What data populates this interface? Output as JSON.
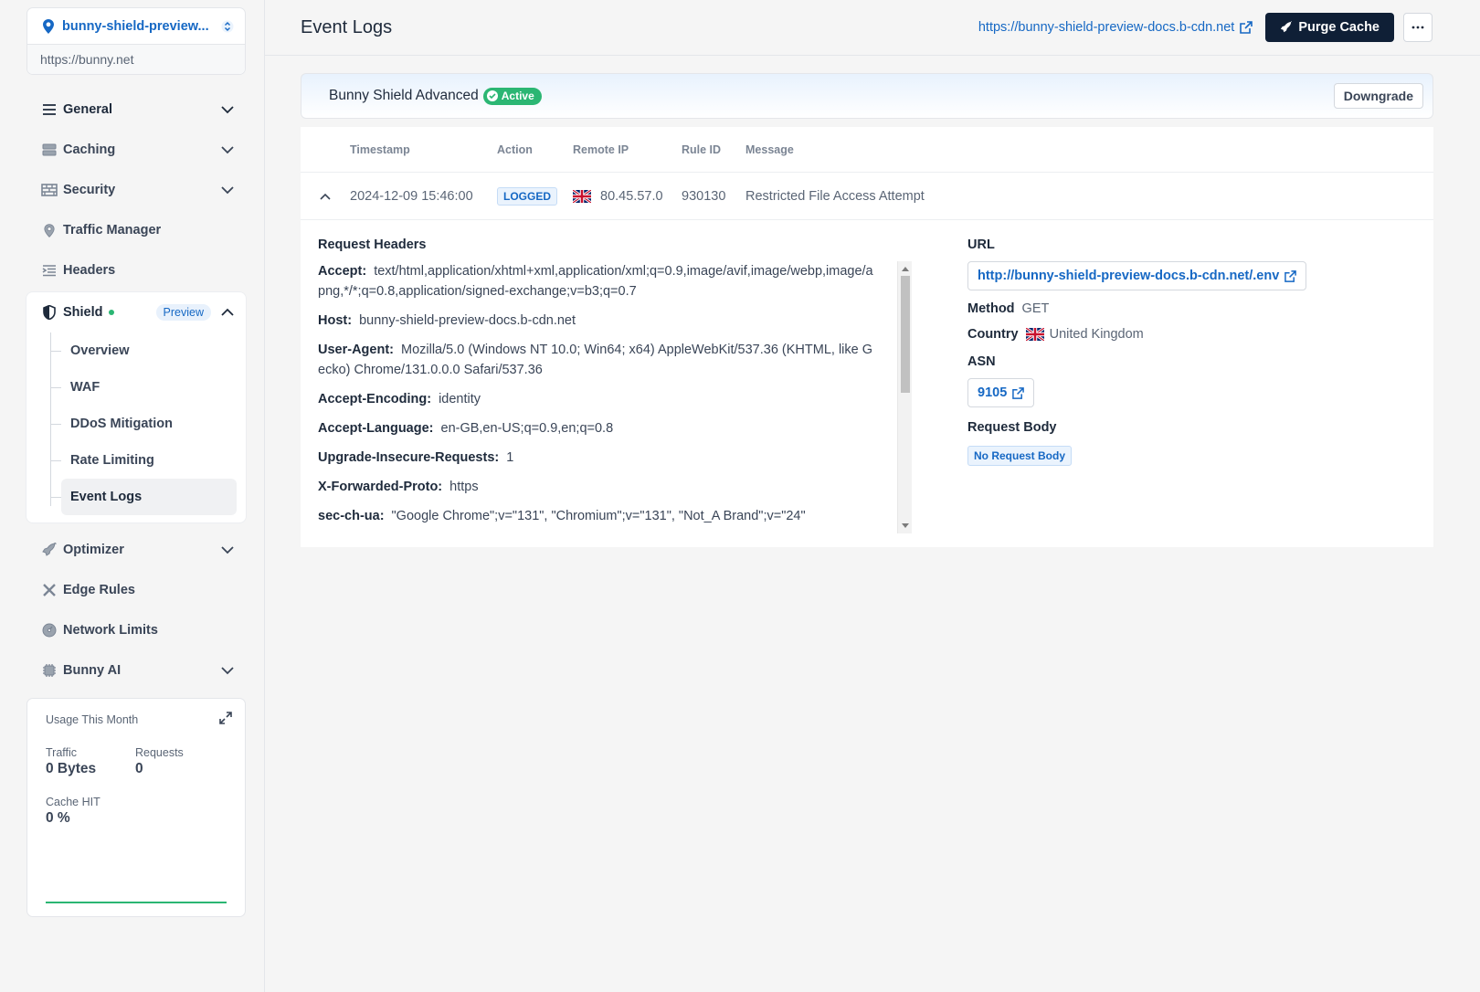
{
  "zone": {
    "name": "bunny-shield-preview...",
    "url": "https://bunny.net"
  },
  "nav": {
    "general": "General",
    "caching": "Caching",
    "security": "Security",
    "traffic_manager": "Traffic Manager",
    "headers": "Headers",
    "shield": "Shield",
    "shield_badge": "Preview",
    "shield_items": [
      "Overview",
      "WAF",
      "DDoS Mitigation",
      "Rate Limiting",
      "Event Logs"
    ],
    "optimizer": "Optimizer",
    "edge_rules": "Edge Rules",
    "network_limits": "Network Limits",
    "bunny_ai": "Bunny AI"
  },
  "usage": {
    "title": "Usage This Month",
    "traffic_label": "Traffic",
    "traffic_value": "0 Bytes",
    "requests_label": "Requests",
    "requests_value": "0",
    "cache_label": "Cache HIT",
    "cache_value": "0 %"
  },
  "header": {
    "title": "Event Logs",
    "docs_link": "https://bunny-shield-preview-docs.b-cdn.net",
    "purge_label": "Purge Cache",
    "more_label": "···"
  },
  "plan": {
    "name": "Bunny Shield Advanced",
    "status": "Active",
    "downgrade_label": "Downgrade"
  },
  "table": {
    "columns": [
      "Timestamp",
      "Action",
      "Remote IP",
      "Rule ID",
      "Message"
    ],
    "row": {
      "timestamp": "2024-12-09 15:46:00",
      "action": "LOGGED",
      "remote_ip": "80.45.57.0",
      "rule_id": "930130",
      "message": "Restricted File Access Attempt"
    }
  },
  "details": {
    "headers_title": "Request Headers",
    "headers": [
      {
        "k": "Accept:",
        "v": "text/html,application/xhtml+xml,application/xml;q=0.9,image/avif,image/webp,image/apng,*/*;q=0.8,application/signed-exchange;v=b3;q=0.7"
      },
      {
        "k": "Host:",
        "v": "bunny-shield-preview-docs.b-cdn.net"
      },
      {
        "k": "User-Agent:",
        "v": "Mozilla/5.0 (Windows NT 10.0; Win64; x64) AppleWebKit/537.36 (KHTML, like Gecko) Chrome/131.0.0.0 Safari/537.36"
      },
      {
        "k": "Accept-Encoding:",
        "v": "identity"
      },
      {
        "k": "Accept-Language:",
        "v": "en-GB,en-US;q=0.9,en;q=0.8"
      },
      {
        "k": "Upgrade-Insecure-Requests:",
        "v": "1"
      },
      {
        "k": "X-Forwarded-Proto:",
        "v": "https"
      },
      {
        "k": "sec-ch-ua:",
        "v": "\"Google Chrome\";v=\"131\", \"Chromium\";v=\"131\", \"Not_A Brand\";v=\"24\""
      }
    ],
    "url_label": "URL",
    "url_value": "http://bunny-shield-preview-docs.b-cdn.net/.env",
    "method_label": "Method",
    "method_value": "GET",
    "country_label": "Country",
    "country_value": "United Kingdom",
    "asn_label": "ASN",
    "asn_value": "9105",
    "body_label": "Request Body",
    "body_value": "No Request Body"
  },
  "colors": {
    "accent": "#1668c4",
    "success": "#2bb673",
    "dark_button": "#0f1f36"
  }
}
